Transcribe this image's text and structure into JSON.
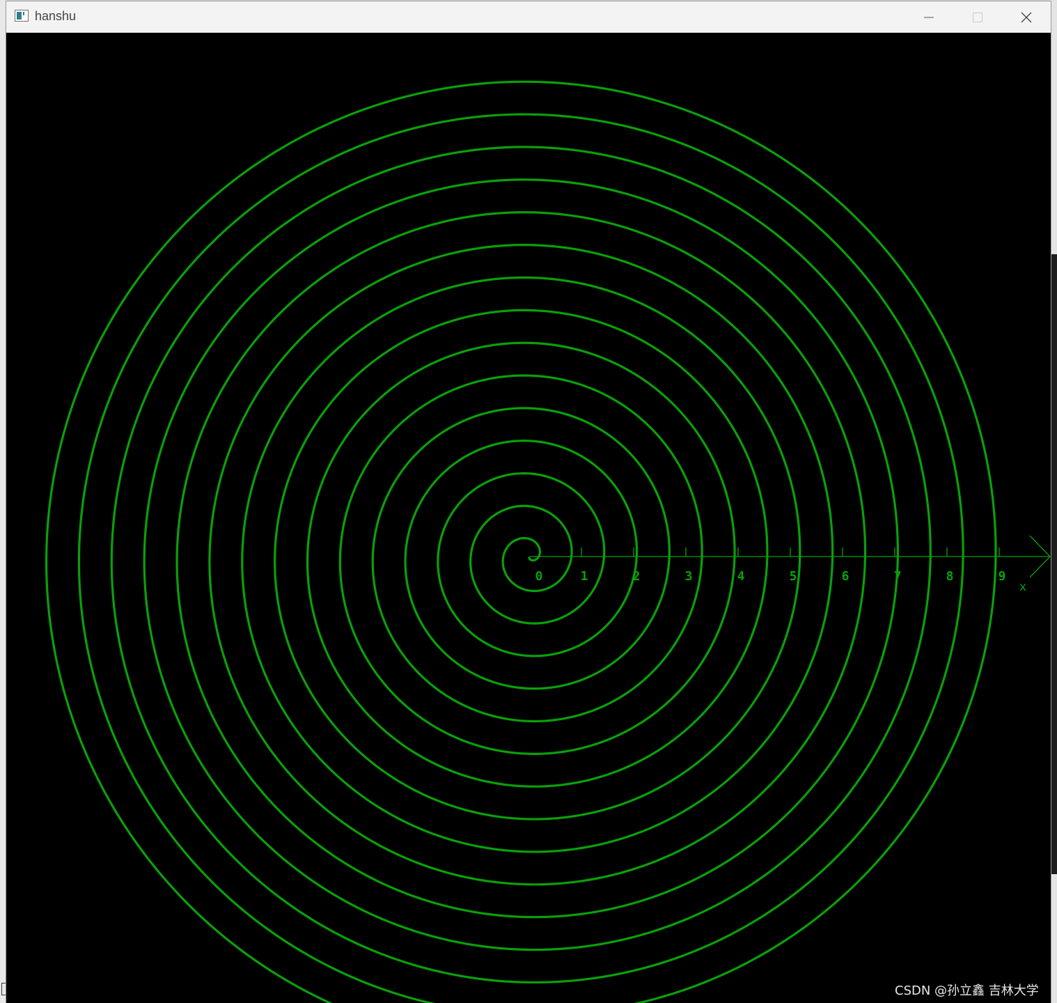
{
  "window": {
    "title": "hanshu",
    "controls": {
      "minimize": "minimize-icon",
      "maximize": "maximize-icon",
      "close": "close-icon"
    }
  },
  "colors": {
    "curve": "#0aa00a",
    "axis": "#0aa00a",
    "background": "#000000"
  },
  "chart_data": {
    "type": "line",
    "curve": "archimedean-spiral",
    "turns": 15,
    "axis": {
      "tick_labels": [
        "0",
        "1",
        "2",
        "3",
        "4",
        "5",
        "6",
        "7",
        "8",
        "9"
      ],
      "end_label": "x"
    }
  },
  "watermark": "CSDN @孙立鑫 吉林大学"
}
